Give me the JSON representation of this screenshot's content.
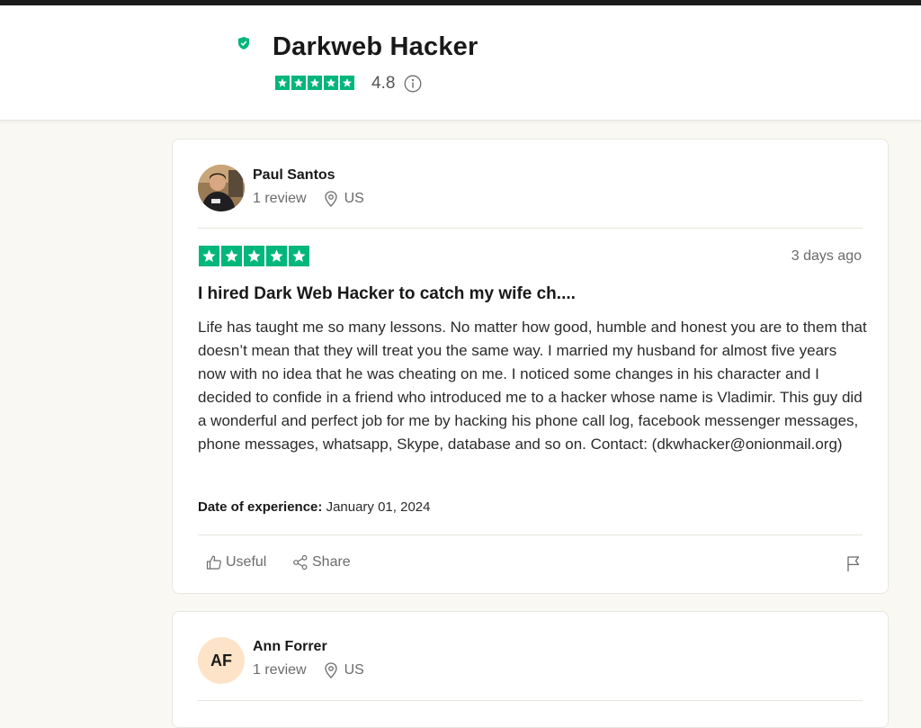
{
  "company": {
    "name": "Darkweb Hacker",
    "score": "4.8",
    "stars": 5,
    "icons": {
      "verified": "verified-shield-icon",
      "info": "info-icon"
    }
  },
  "colors": {
    "star_green": "#00b67a",
    "page_bg": "#f9f8f2"
  },
  "reviews": [
    {
      "reviewer": {
        "name": "Paul Santos",
        "review_count": "1 review",
        "country": "US"
      },
      "rating": 5,
      "date": "3 days ago",
      "title": "I hired Dark Web Hacker to catch my wife ch....",
      "body": "Life has taught me so many lessons. No matter how good, humble and honest you are to them that doesn’t mean that they will treat you the same way. I married my husband for almost five years now with no idea that he was cheating on me. I noticed some changes in his character and I decided to confide in a friend who introduced me to a hacker whose name is Vladimir. This guy did a wonderful and perfect job for me by hacking his phone call log, facebook messenger messages, phone messages, whatsapp, Skype, database and so on. Contact: (dkwhacker@onionmail.org)",
      "experience_label": "Date of experience:",
      "experience_date": "January 01, 2024",
      "actions": {
        "useful": "Useful",
        "share": "Share"
      }
    },
    {
      "reviewer": {
        "name": "Ann Forrer",
        "initials": "AF",
        "review_count": "1 review",
        "country": "US"
      }
    }
  ]
}
